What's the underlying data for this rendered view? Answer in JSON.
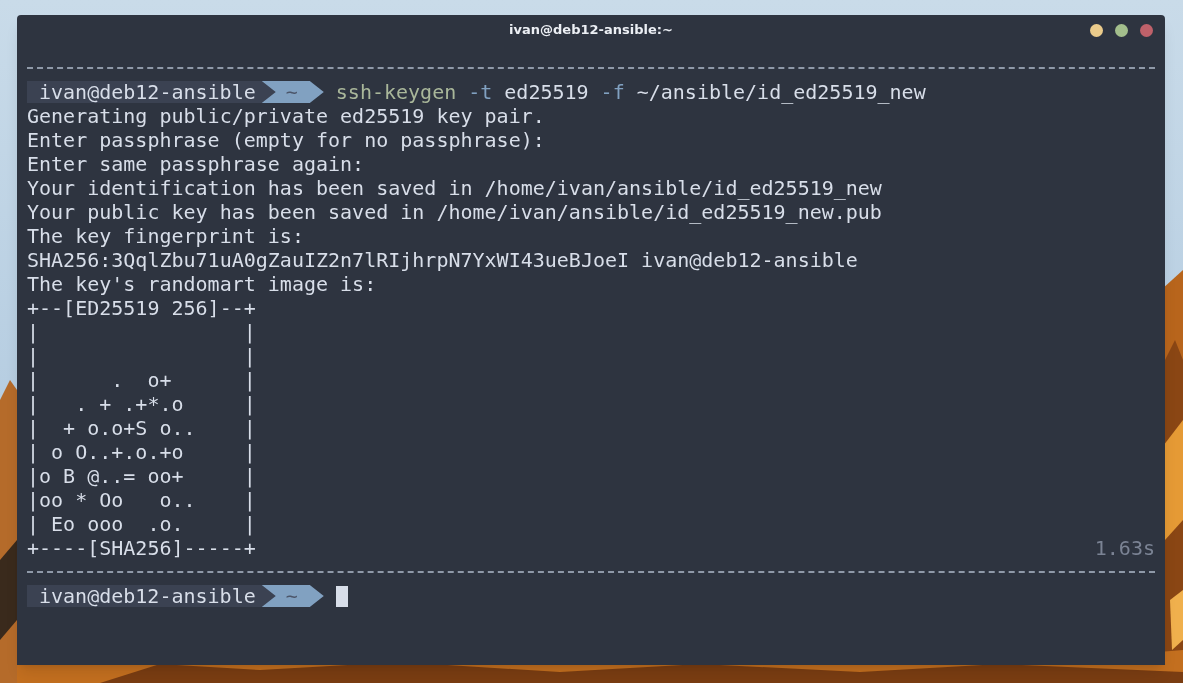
{
  "window": {
    "title": "ivan@deb12-ansible:~",
    "buttons": [
      {
        "color": "#ebcb8b"
      },
      {
        "color": "#a3be8c"
      },
      {
        "color": "#bf616a"
      }
    ]
  },
  "blocks": [
    {
      "prompt": {
        "user_host": "ivan@deb12-ansible",
        "directory": "~",
        "command": [
          {
            "text": "ssh-keygen",
            "kind": "program"
          },
          {
            "text": "-t",
            "kind": "flag"
          },
          {
            "text": "ed25519",
            "kind": "arg"
          },
          {
            "text": "-f",
            "kind": "flag"
          },
          {
            "text": "~/ansible/id_ed25519_new",
            "kind": "arg"
          }
        ]
      },
      "output": [
        "Generating public/private ed25519 key pair.",
        "Enter passphrase (empty for no passphrase):",
        "Enter same passphrase again:",
        "Your identification has been saved in /home/ivan/ansible/id_ed25519_new",
        "Your public key has been saved in /home/ivan/ansible/id_ed25519_new.pub",
        "The key fingerprint is:",
        "SHA256:3QqlZbu71uA0gZauIZ2n7lRIjhrpN7YxWI43ueBJoeI ivan@deb12-ansible",
        "The key's randomart image is:",
        "+--[ED25519 256]--+",
        "|                 |",
        "|                 |",
        "|      .  o+      |",
        "|   . + .+*.o     |",
        "|  + o.o+S o..    |",
        "| o O..+.o.+o     |",
        "|o B @..= oo+     |",
        "|oo * Oo   o..    |",
        "| Eo ooo  .o.     |",
        "+----[SHA256]-----+"
      ],
      "duration": "1.63s"
    },
    {
      "prompt": {
        "user_host": "ivan@deb12-ansible",
        "directory": "~",
        "cursor": true
      }
    }
  ]
}
